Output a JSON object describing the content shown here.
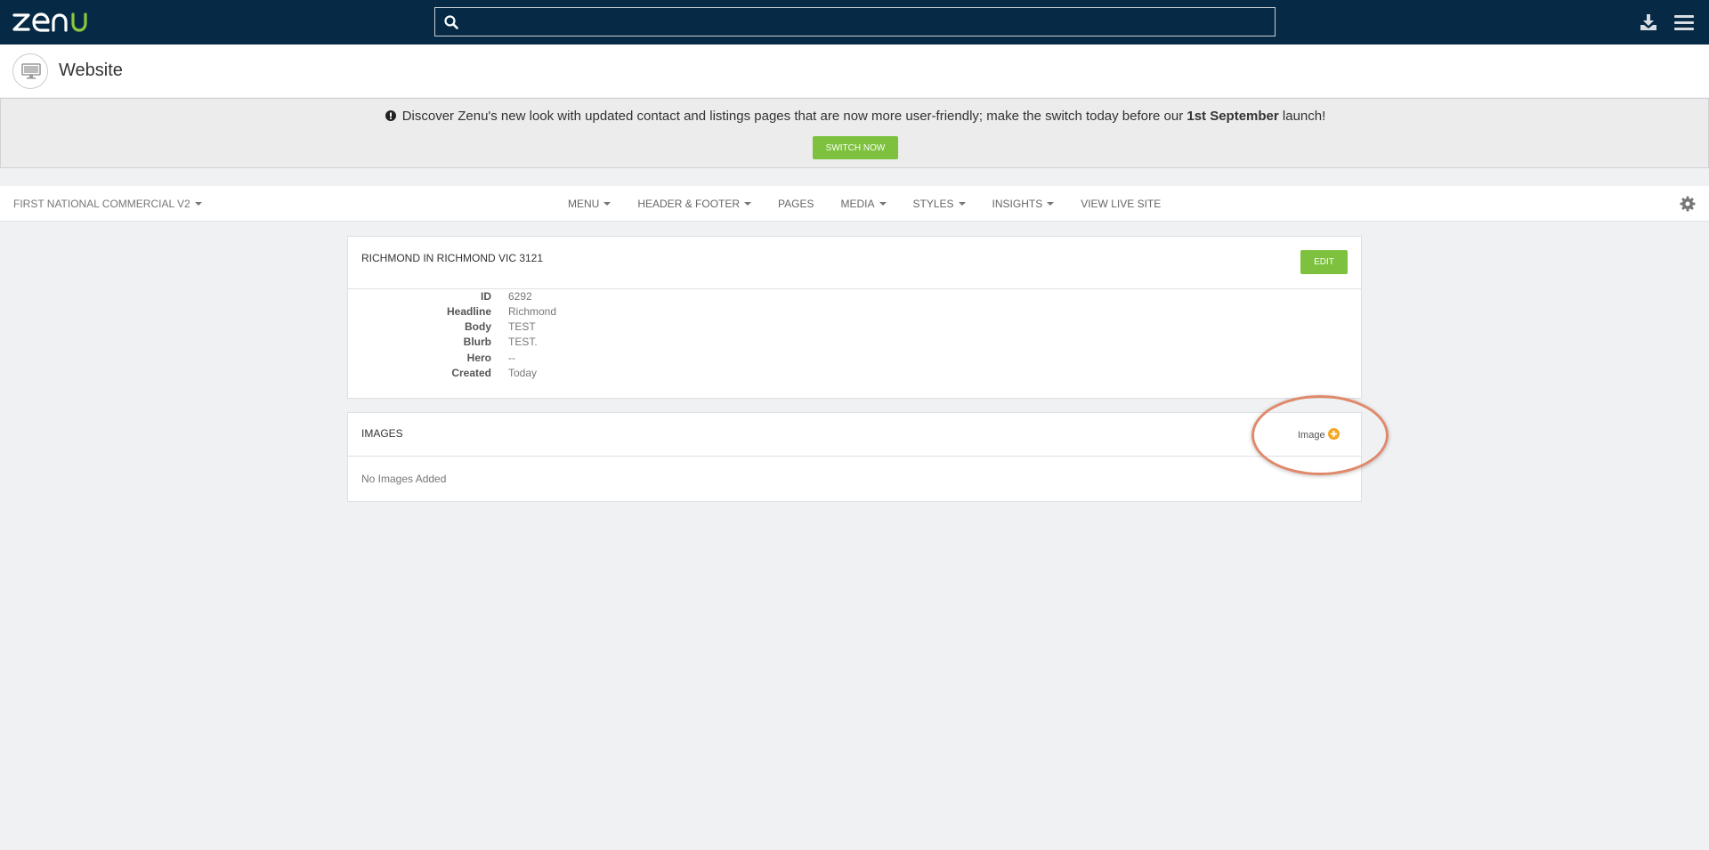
{
  "app": {
    "logo_text": "zenu",
    "search_placeholder": ""
  },
  "page": {
    "title": "Website"
  },
  "notice": {
    "text_before": "Discover Zenu's new look with updated contact and listings pages that are now more user-friendly; make the switch today before our ",
    "text_bold": "1st September",
    "text_after": " launch!",
    "button_label": "SWITCH NOW"
  },
  "subnav": {
    "site": "FIRST NATIONAL COMMERCIAL V2",
    "items": [
      "MENU",
      "HEADER & FOOTER",
      "PAGES",
      "MEDIA",
      "STYLES",
      "INSIGHTS",
      "VIEW LIVE SITE"
    ]
  },
  "details_card": {
    "title": "RICHMOND IN RICHMOND VIC 3121",
    "edit_label": "EDIT",
    "fields": [
      {
        "label": "ID",
        "value": "6292"
      },
      {
        "label": "Headline",
        "value": "Richmond"
      },
      {
        "label": "Body",
        "value": "TEST"
      },
      {
        "label": "Blurb",
        "value": "TEST."
      },
      {
        "label": "Hero",
        "value": "--"
      },
      {
        "label": "Created",
        "value": "Today"
      }
    ]
  },
  "images_card": {
    "title": "IMAGES",
    "add_label": "Image",
    "empty_text": "No Images Added"
  },
  "colors": {
    "topbar": "#062a45",
    "accent_green": "#7dc13e",
    "add_icon": "#f5a623",
    "annotation": "#e0896a"
  }
}
